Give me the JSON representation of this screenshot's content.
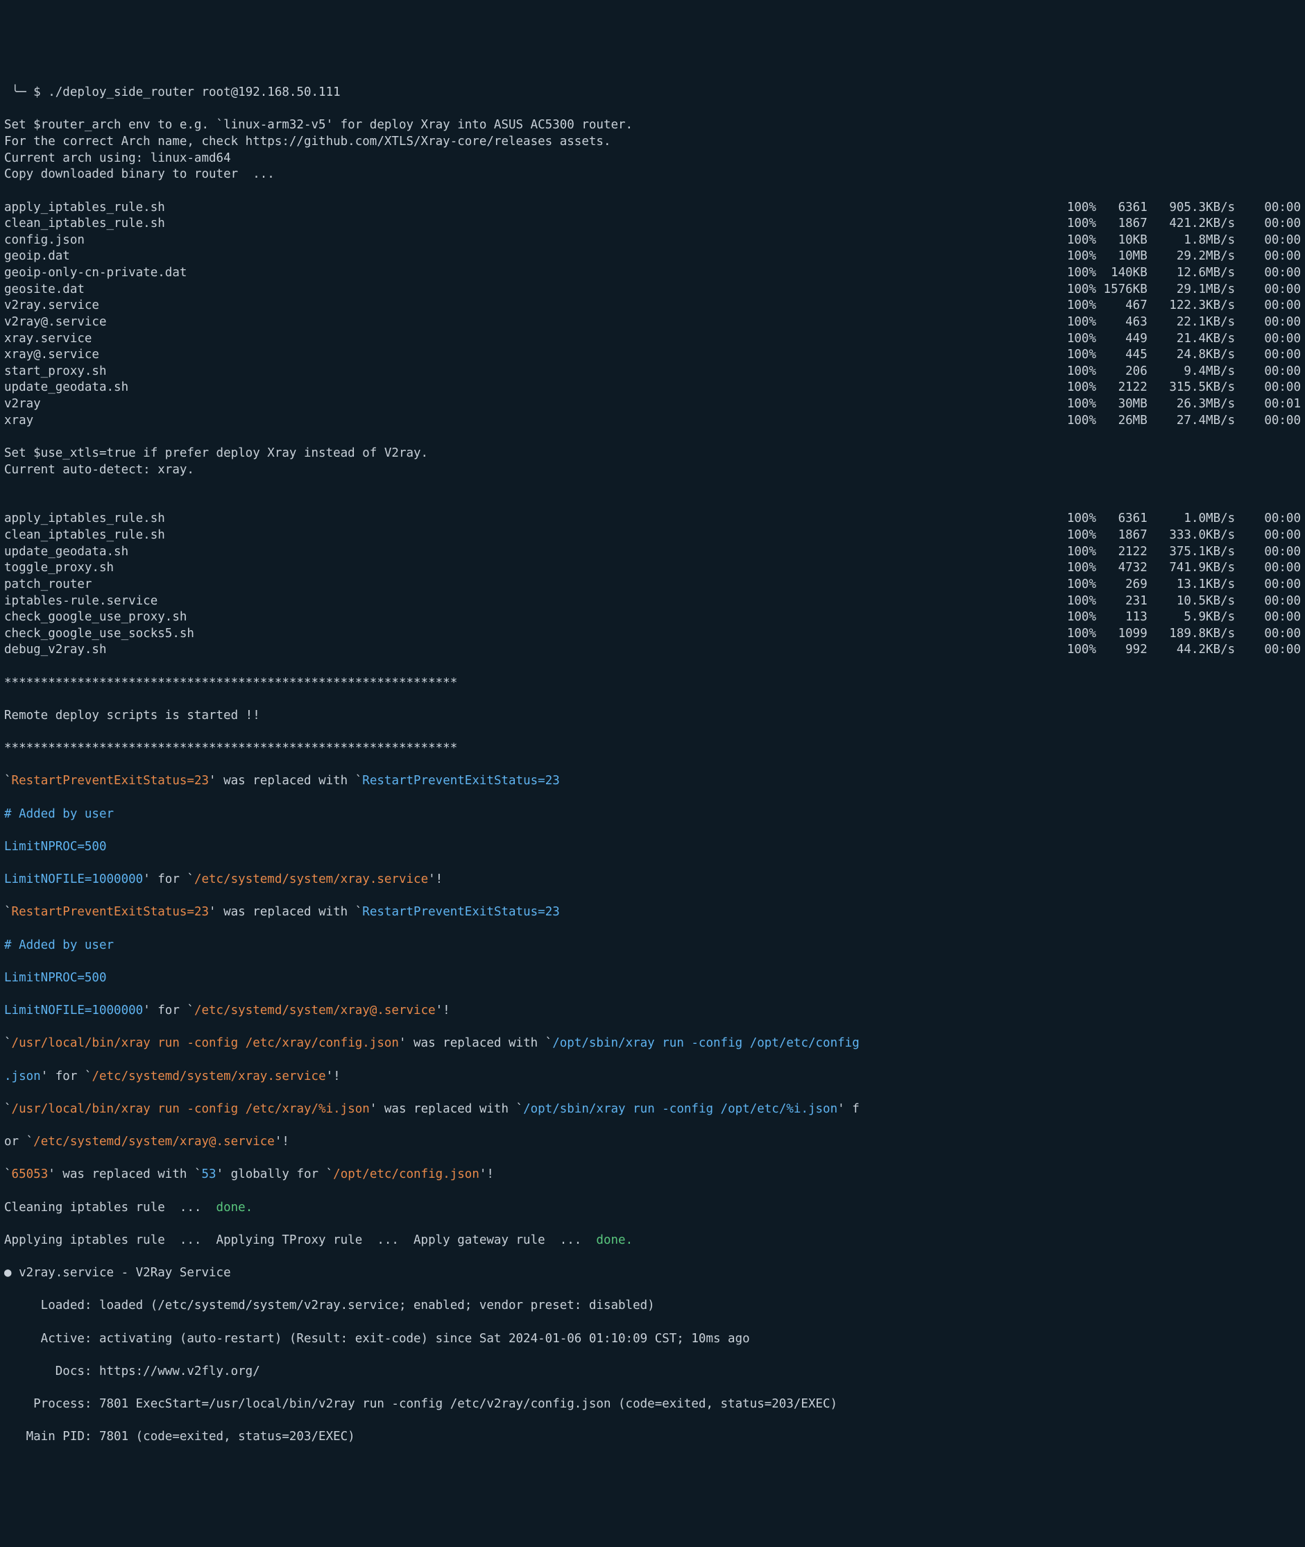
{
  "prompt": {
    "tree": " ╰─",
    "symbol": " $ ",
    "command": "./deploy_side_router root@192.168.50.111"
  },
  "intro": [
    "Set $router_arch env to e.g. `linux-arm32-v5' for deploy Xray into ASUS AC5300 router.",
    "For the correct Arch name, check https://github.com/XTLS/Xray-core/releases assets.",
    "Current arch using: linux-amd64",
    "Copy downloaded binary to router  ..."
  ],
  "transfers1": [
    {
      "name": "apply_iptables_rule.sh",
      "pct": "100%",
      "sz": "6361",
      "rate": "905.3KB/s",
      "eta": "00:00"
    },
    {
      "name": "clean_iptables_rule.sh",
      "pct": "100%",
      "sz": "1867",
      "rate": "421.2KB/s",
      "eta": "00:00"
    },
    {
      "name": "config.json",
      "pct": "100%",
      "sz": "10KB",
      "rate": "1.8MB/s",
      "eta": "00:00"
    },
    {
      "name": "geoip.dat",
      "pct": "100%",
      "sz": "10MB",
      "rate": "29.2MB/s",
      "eta": "00:00"
    },
    {
      "name": "geoip-only-cn-private.dat",
      "pct": "100%",
      "sz": "140KB",
      "rate": "12.6MB/s",
      "eta": "00:00"
    },
    {
      "name": "geosite.dat",
      "pct": "100%",
      "sz": "1576KB",
      "rate": "29.1MB/s",
      "eta": "00:00"
    },
    {
      "name": "v2ray.service",
      "pct": "100%",
      "sz": "467",
      "rate": "122.3KB/s",
      "eta": "00:00"
    },
    {
      "name": "v2ray@.service",
      "pct": "100%",
      "sz": "463",
      "rate": "22.1KB/s",
      "eta": "00:00"
    },
    {
      "name": "xray.service",
      "pct": "100%",
      "sz": "449",
      "rate": "21.4KB/s",
      "eta": "00:00"
    },
    {
      "name": "xray@.service",
      "pct": "100%",
      "sz": "445",
      "rate": "24.8KB/s",
      "eta": "00:00"
    },
    {
      "name": "start_proxy.sh",
      "pct": "100%",
      "sz": "206",
      "rate": "9.4MB/s",
      "eta": "00:00"
    },
    {
      "name": "update_geodata.sh",
      "pct": "100%",
      "sz": "2122",
      "rate": "315.5KB/s",
      "eta": "00:00"
    },
    {
      "name": "v2ray",
      "pct": "100%",
      "sz": "30MB",
      "rate": "26.3MB/s",
      "eta": "00:01"
    },
    {
      "name": "xray",
      "pct": "100%",
      "sz": "26MB",
      "rate": "27.4MB/s",
      "eta": "00:00"
    }
  ],
  "mid": [
    "Set $use_xtls=true if prefer deploy Xray instead of V2ray.",
    "Current auto-detect: xray.",
    ""
  ],
  "transfers2": [
    {
      "name": "apply_iptables_rule.sh",
      "pct": "100%",
      "sz": "6361",
      "rate": "1.0MB/s",
      "eta": "00:00"
    },
    {
      "name": "clean_iptables_rule.sh",
      "pct": "100%",
      "sz": "1867",
      "rate": "333.0KB/s",
      "eta": "00:00"
    },
    {
      "name": "update_geodata.sh",
      "pct": "100%",
      "sz": "2122",
      "rate": "375.1KB/s",
      "eta": "00:00"
    },
    {
      "name": "toggle_proxy.sh",
      "pct": "100%",
      "sz": "4732",
      "rate": "741.9KB/s",
      "eta": "00:00"
    },
    {
      "name": "patch_router",
      "pct": "100%",
      "sz": "269",
      "rate": "13.1KB/s",
      "eta": "00:00"
    },
    {
      "name": "iptables-rule.service",
      "pct": "100%",
      "sz": "231",
      "rate": "10.5KB/s",
      "eta": "00:00"
    },
    {
      "name": "check_google_use_proxy.sh",
      "pct": "100%",
      "sz": "113",
      "rate": "5.9KB/s",
      "eta": "00:00"
    },
    {
      "name": "check_google_use_socks5.sh",
      "pct": "100%",
      "sz": "1099",
      "rate": "189.8KB/s",
      "eta": "00:00"
    },
    {
      "name": "debug_v2ray.sh",
      "pct": "100%",
      "sz": "992",
      "rate": "44.2KB/s",
      "eta": "00:00"
    }
  ],
  "stars1": "**************************************************************",
  "started": "Remote deploy scripts is started !!",
  "stars2": "**************************************************************",
  "replace_lines": {
    "l1_tick": "`",
    "l1_a": "RestartPreventExitStatus=23",
    "l1_mid": "' was replaced with `",
    "l1_b": "RestartPreventExitStatus=23",
    "added": "# Added by user",
    "nproc": "LimitNPROC=500",
    "nofile": "LimitNOFILE=1000000",
    "nofile_mid": "' for `",
    "nofile_path1": "/etc/systemd/system/xray.service",
    "nofile_end": "'!",
    "nofile_path2": "/etc/systemd/system/xray@.service",
    "bin1_a": "/usr/local/bin/xray run -config /etc/xray/config.json",
    "bin1_mid": "' was replaced with `",
    "bin1_b": "/opt/sbin/xray run -config /opt/etc/config",
    "json_tail1": ".json",
    "for_text": "' for `",
    "svc_path1": "/etc/systemd/system/xray.service",
    "bang": "'!",
    "bin2_a": "/usr/local/bin/xray run -config /etc/xray/%i.json",
    "bin2_b": "/opt/sbin/xray run -config /opt/etc/%i.json",
    "bin2_tail": "' f",
    "or_text": "or `",
    "svc_path2": "/etc/systemd/system/xray@.service",
    "port_a": "65053",
    "port_mid": "' was replaced with `",
    "port_b": "53",
    "port_mid2": "' globally for `",
    "port_path": "/opt/etc/config.json"
  },
  "clean": {
    "pre": "Cleaning iptables rule  ...  ",
    "done": "done."
  },
  "apply": {
    "pre": "Applying iptables rule  ...  Applying TProxy rule  ...  Apply gateway rule  ...  ",
    "done": "done."
  },
  "service": {
    "header": "● v2ray.service - V2Ray Service",
    "loaded": "     Loaded: loaded (/etc/systemd/system/v2ray.service; enabled; vendor preset: disabled)",
    "active": "     Active: activating (auto-restart) (Result: exit-code) since Sat 2024-01-06 01:10:09 CST; 10ms ago",
    "docs": "       Docs: https://www.v2fly.org/",
    "process": "    Process: 7801 ExecStart=/usr/local/bin/v2ray run -config /etc/v2ray/config.json (code=exited, status=203/EXEC)",
    "mainpid": "   Main PID: 7801 (code=exited, status=203/EXEC)"
  }
}
